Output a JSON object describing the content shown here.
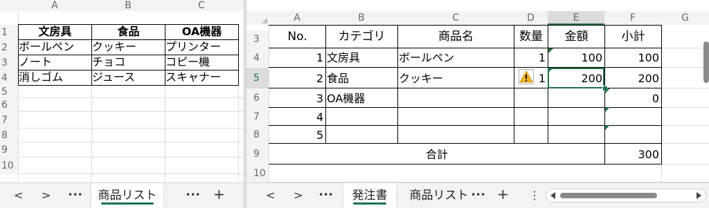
{
  "left": {
    "columns": [
      "A",
      "B",
      "C"
    ],
    "rows": [
      "1",
      "2",
      "3",
      "4",
      "5",
      "6",
      "7",
      "8",
      "9",
      "10"
    ],
    "cells": [
      [
        "文房具",
        "食品",
        "OA機器"
      ],
      [
        "ボールペン",
        "クッキー",
        "プリンター"
      ],
      [
        "ノート",
        "チョコ",
        "コピー機"
      ],
      [
        "消しゴム",
        "ジュース",
        "スキャナー"
      ]
    ],
    "tabs": {
      "prev": "<",
      "next": ">",
      "more": "•••",
      "sheet": "商品リスト",
      "more2": "•••",
      "add": "+"
    }
  },
  "right": {
    "columns": [
      "A",
      "B",
      "C",
      "D",
      "E",
      "F",
      "G"
    ],
    "rows": [
      "3",
      "4",
      "5",
      "6",
      "7",
      "8",
      "9",
      "10"
    ],
    "header": [
      "No.",
      "カテゴリ",
      "商品名",
      "数量",
      "金額",
      "小計"
    ],
    "table": [
      {
        "no": "1",
        "category": "文房具",
        "product": "ボールペン",
        "qty": "1",
        "amount": "100",
        "subtotal": "100"
      },
      {
        "no": "2",
        "category": "食品",
        "product": "クッキー",
        "qty": "1",
        "amount": "200",
        "subtotal": "200"
      },
      {
        "no": "3",
        "category": "OA機器",
        "product": "",
        "qty": "",
        "amount": "",
        "subtotal": "0"
      },
      {
        "no": "4",
        "category": "",
        "product": "",
        "qty": "",
        "amount": "",
        "subtotal": ""
      },
      {
        "no": "5",
        "category": "",
        "product": "",
        "qty": "",
        "amount": "",
        "subtotal": ""
      }
    ],
    "total_label": "合計",
    "total_value": "300",
    "tabs": {
      "prev": "<",
      "next": ">",
      "more": "•••",
      "active": "発注書",
      "other": "商品リスト",
      "more2": "•••",
      "add": "+",
      "options": "⋮"
    },
    "warning_icon": "warning-icon",
    "accent": "#1e7145"
  }
}
